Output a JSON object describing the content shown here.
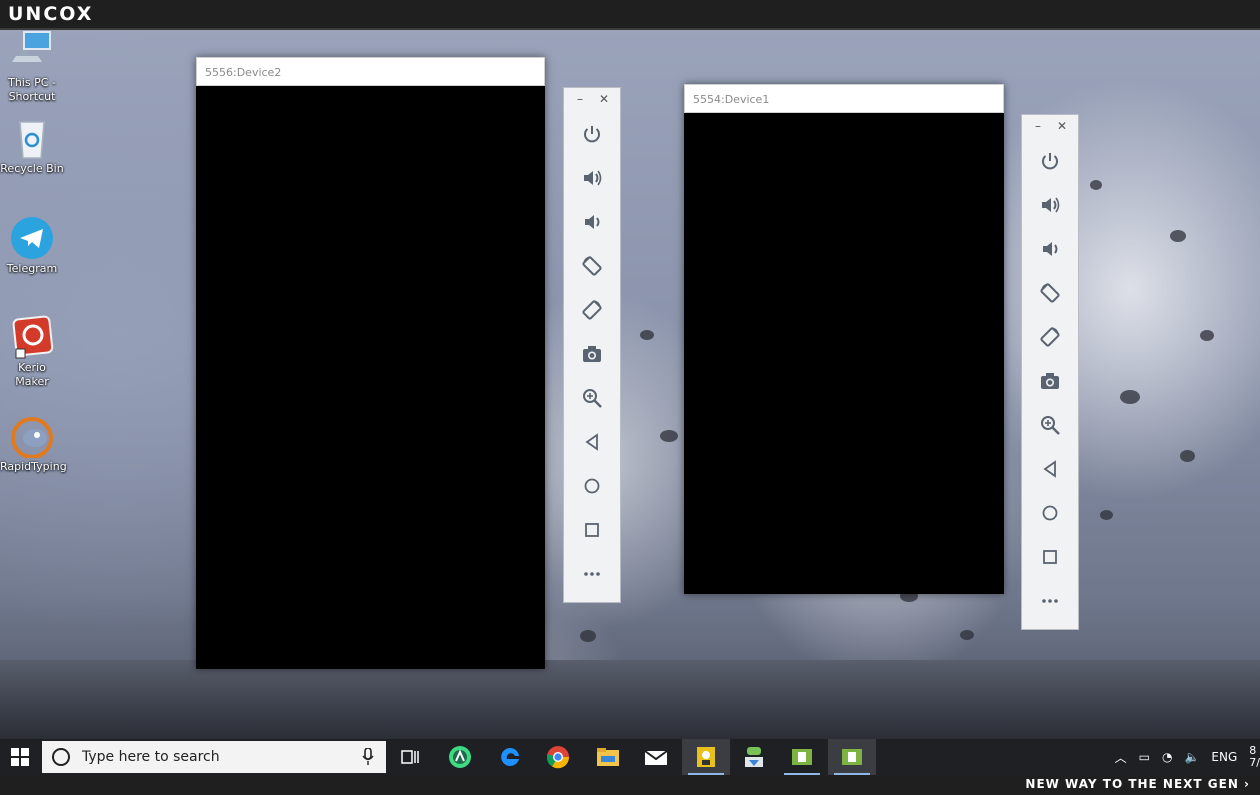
{
  "brand": "UNCOX",
  "desktop_icons": [
    {
      "name": "this-pc-shortcut",
      "label": "This PC - Shortcut",
      "icon": "computer-icon"
    },
    {
      "name": "recycle-bin",
      "label": "Recycle Bin",
      "icon": "recycle-bin-icon"
    },
    {
      "name": "telegram",
      "label": "Telegram",
      "icon": "telegram-icon"
    },
    {
      "name": "kerio-maker",
      "label": "Kerio Maker",
      "icon": "kerio-icon"
    },
    {
      "name": "rapidtyping",
      "label": "RapidTyping",
      "icon": "rapidtyping-icon"
    }
  ],
  "device_windows": [
    {
      "title": "5556:Device2"
    },
    {
      "title": "5554:Device1"
    }
  ],
  "device_controls": [
    "power-icon",
    "volume-up-icon",
    "volume-down-icon",
    "rotate-left-icon",
    "rotate-right-icon",
    "camera-icon",
    "zoom-icon",
    "back-icon",
    "home-icon",
    "overview-icon",
    "more-icon"
  ],
  "panel_buttons": {
    "minimize": "–",
    "close": "✕"
  },
  "taskbar": {
    "search_placeholder": "Type here to search",
    "apps": [
      "task-view-icon",
      "android-studio-icon",
      "edge-icon",
      "chrome-icon",
      "file-explorer-icon",
      "mail-icon",
      "app-icon",
      "download-icon",
      "emulator-icon",
      "emulator-icon"
    ],
    "language": "ENG",
    "clock_partial": "8",
    "date_partial": "7/"
  },
  "slogan": "NEW WAY TO THE NEXT GEN ›"
}
